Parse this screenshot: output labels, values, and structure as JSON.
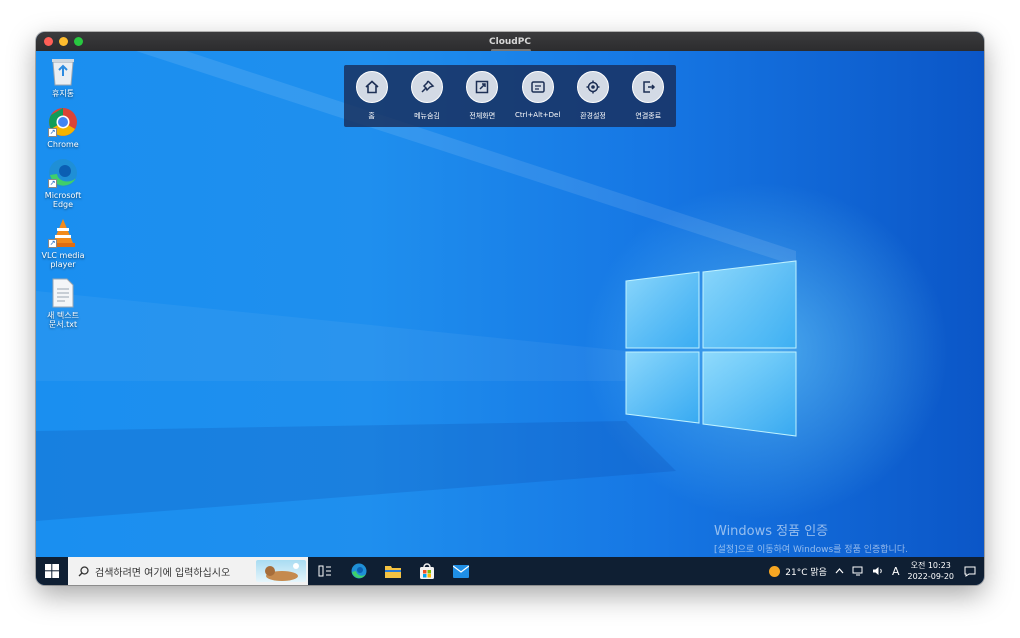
{
  "window": {
    "title": "CloudPC"
  },
  "desktop_icons": [
    {
      "label": "휴지통",
      "icon": "recycle-bin-icon"
    },
    {
      "label": "Chrome",
      "icon": "chrome-icon"
    },
    {
      "label": "Microsoft\nEdge",
      "icon": "edge-icon"
    },
    {
      "label": "VLC media\nplayer",
      "icon": "vlc-icon"
    },
    {
      "label": "새 텍스트\n문서.txt",
      "icon": "text-file-icon"
    }
  ],
  "toolbar": [
    {
      "label": "홈",
      "icon": "home-icon"
    },
    {
      "label": "메뉴숨김",
      "icon": "pin-icon"
    },
    {
      "label": "전체화면",
      "icon": "fullscreen-icon"
    },
    {
      "label": "Ctrl+Alt+Del",
      "icon": "ctrl-alt-del-icon"
    },
    {
      "label": "환경설정",
      "icon": "gear-icon"
    },
    {
      "label": "연결종료",
      "icon": "disconnect-icon"
    }
  ],
  "activation": {
    "title": "Windows 정품 인증",
    "message": "[설정]으로 이동하여 Windows를 정품 인증합니다."
  },
  "taskbar": {
    "search_placeholder": "검색하려면 여기에 입력하십시오",
    "weather": "21°C  맑음",
    "input_mode": "A",
    "time": "오전 10:23",
    "date": "2022-09-20"
  },
  "colors": {
    "desktop_blue": "#1a8ff0",
    "taskbar": "#0f1f33",
    "toolbar_bg": "#192d5a"
  }
}
